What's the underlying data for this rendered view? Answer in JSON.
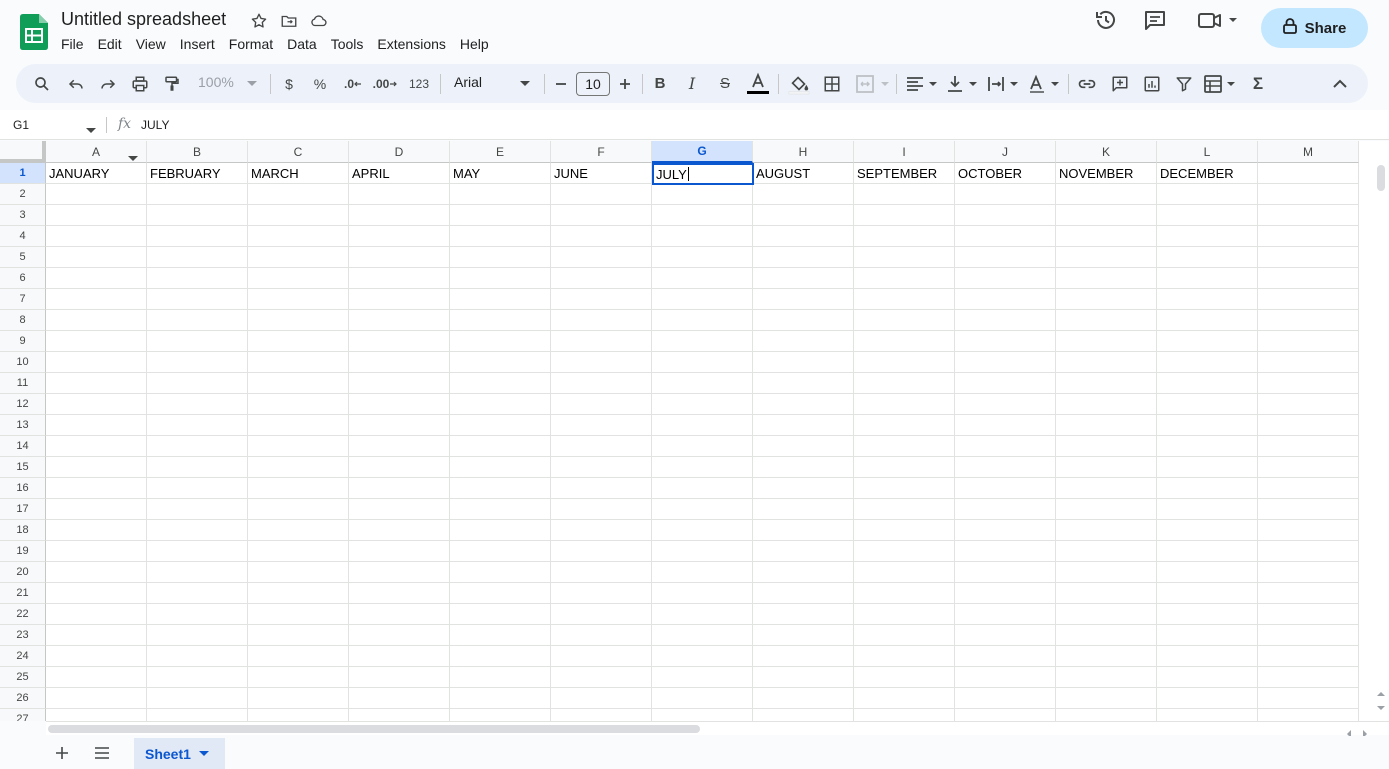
{
  "document": {
    "title": "Untitled spreadsheet",
    "share_label": "Share"
  },
  "menu": [
    "File",
    "Edit",
    "View",
    "Insert",
    "Format",
    "Data",
    "Tools",
    "Extensions",
    "Help"
  ],
  "toolbar": {
    "zoom": "100%",
    "currency": "$",
    "percent": "%",
    "decrease_decimal": ".0",
    "increase_decimal": ".00",
    "number_format": "123",
    "font": "Arial",
    "font_size": "10"
  },
  "formula_bar": {
    "name_box": "G1",
    "fx": "fx",
    "value": "JULY"
  },
  "grid": {
    "columns": [
      "A",
      "B",
      "C",
      "D",
      "E",
      "F",
      "G",
      "H",
      "I",
      "J",
      "K",
      "L",
      "M"
    ],
    "rows": [
      "1",
      "2",
      "3",
      "4",
      "5",
      "6",
      "7",
      "8",
      "9",
      "10",
      "11",
      "12",
      "13",
      "14",
      "15",
      "16",
      "17",
      "18",
      "19",
      "20",
      "21",
      "22",
      "23",
      "24",
      "25",
      "26",
      "27"
    ],
    "row1": [
      "JANUARY",
      "FEBRUARY",
      "MARCH",
      "APRIL",
      "MAY",
      "JUNE",
      "JULY",
      "AUGUST",
      "SEPTEMBER",
      "OCTOBER",
      "NOVEMBER",
      "DECEMBER",
      ""
    ],
    "selected_column": "G",
    "selected_row": "1"
  },
  "sheets": {
    "active": "Sheet1"
  },
  "colors": {
    "accent": "#0b57d0",
    "share_bg": "#c2e7ff",
    "toolbar_bg": "#edf2fa",
    "sheets_green": "#0f9d58"
  }
}
